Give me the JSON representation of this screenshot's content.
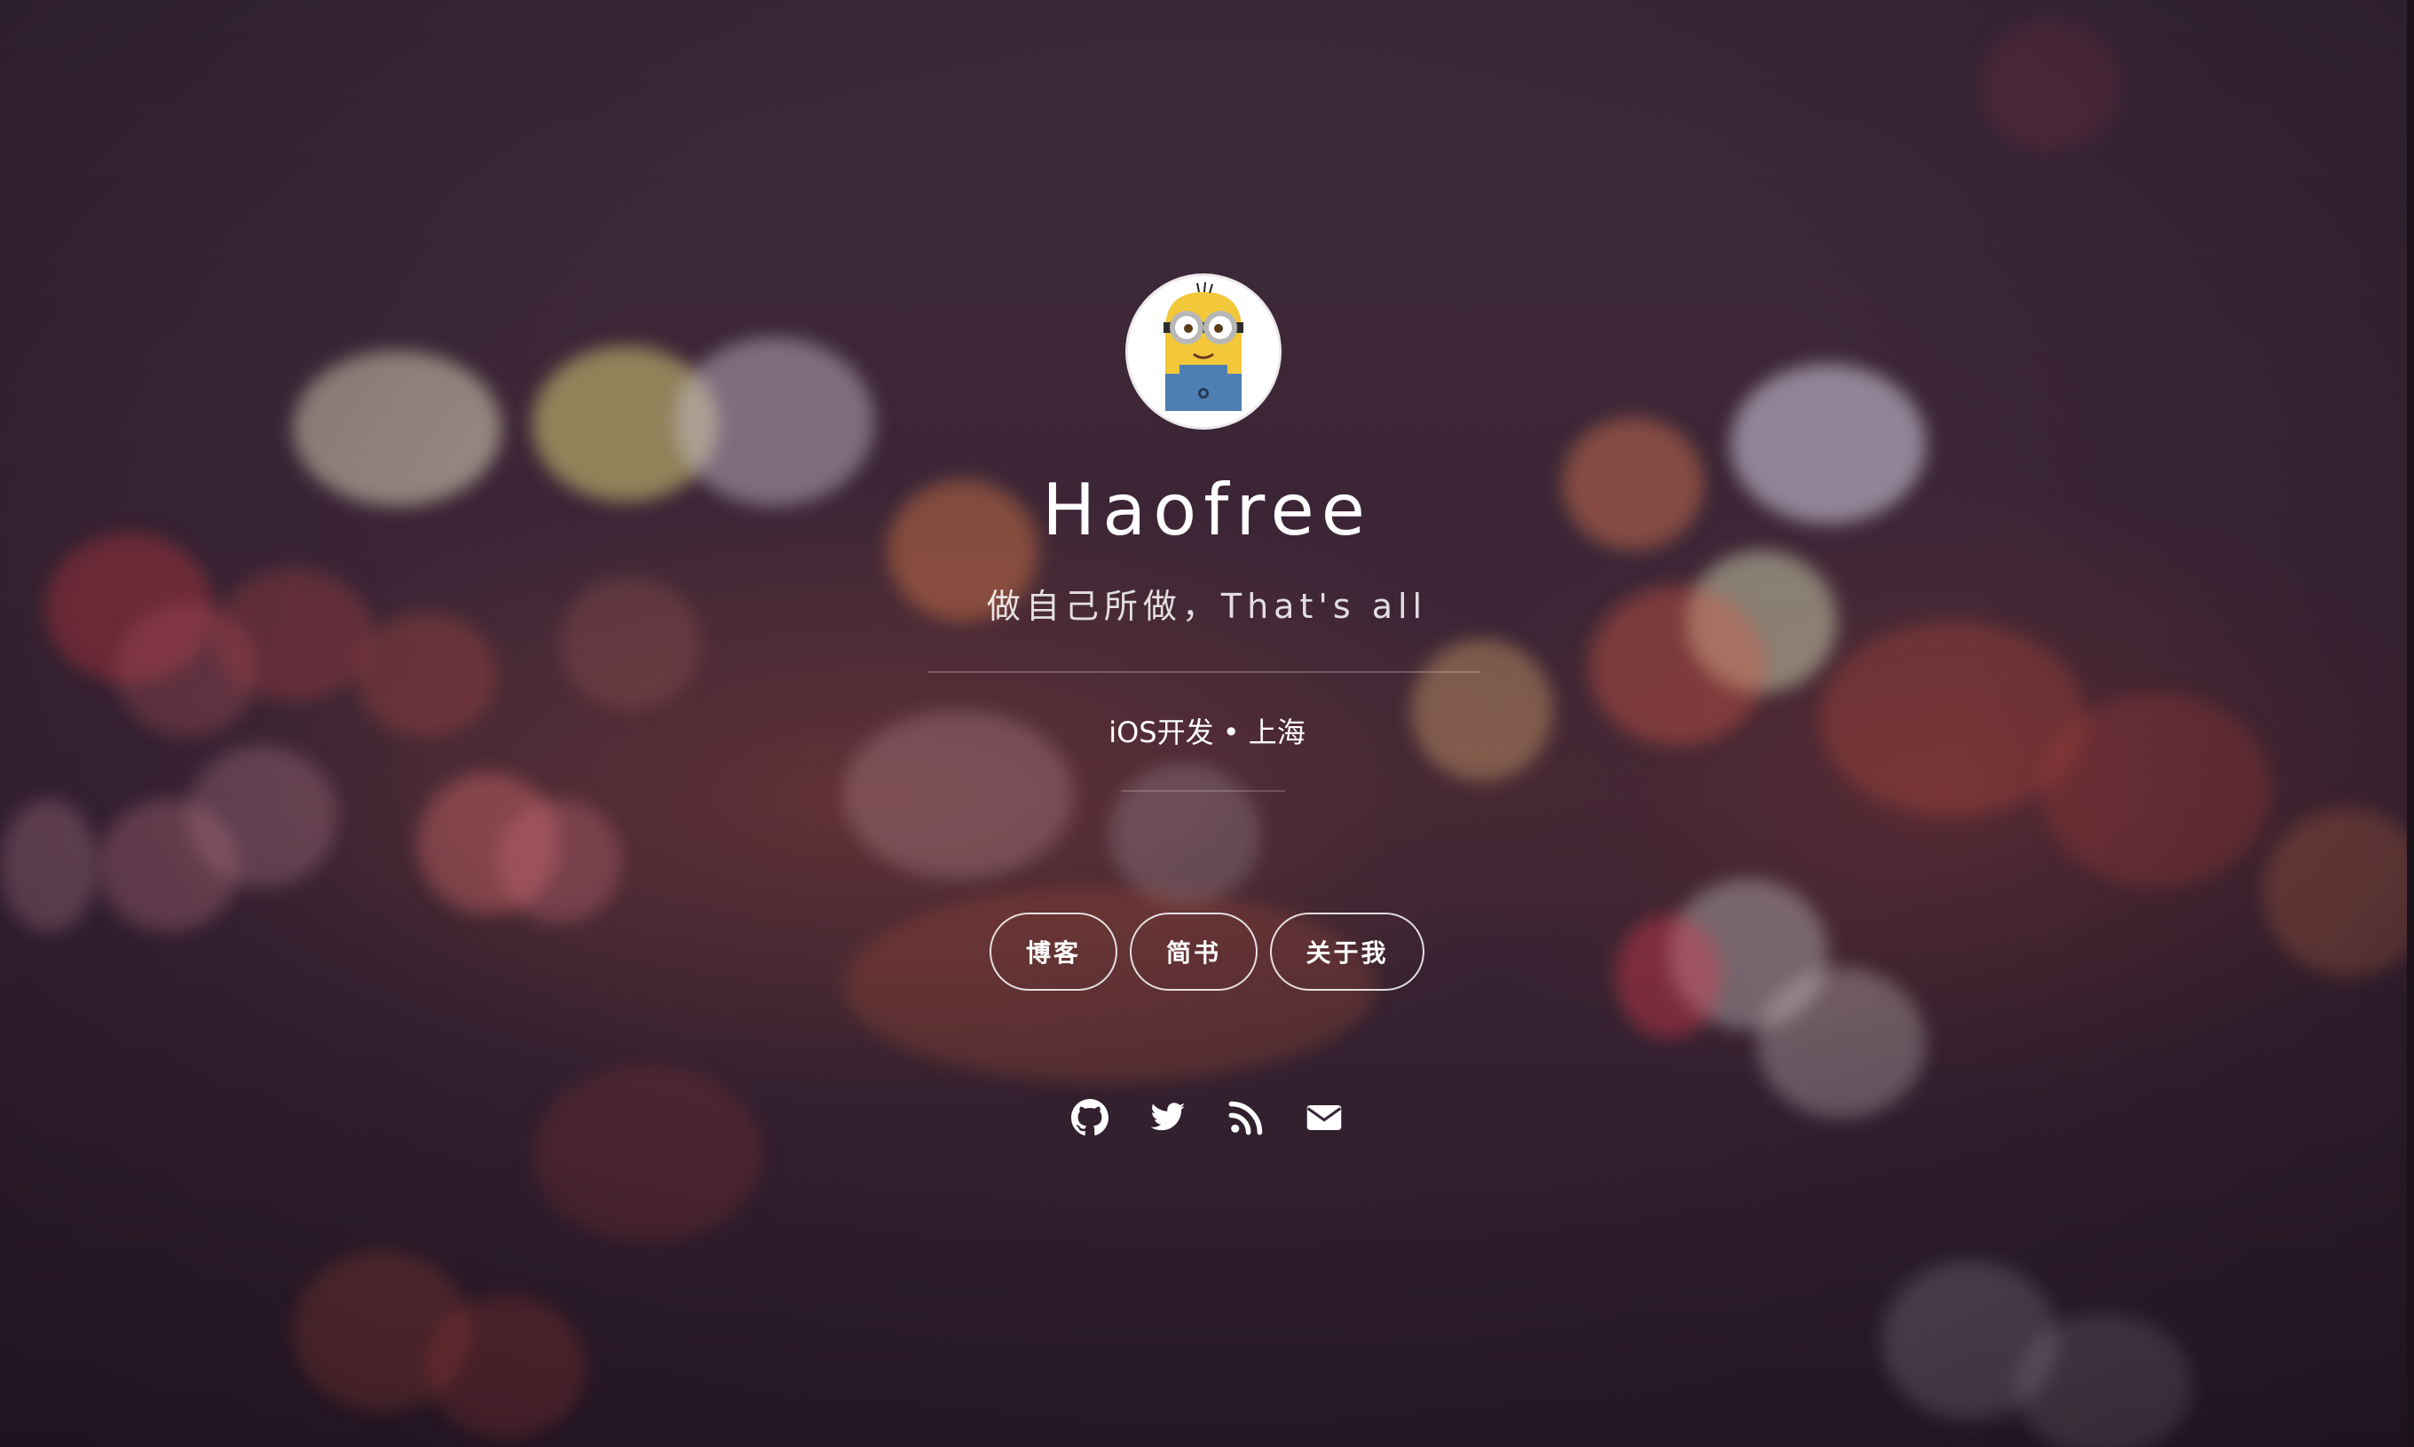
{
  "profile": {
    "name": "Haofree",
    "tagline": "做自己所做，That's all",
    "subtitle": "iOS开发 • 上海"
  },
  "nav": [
    {
      "label": "博客"
    },
    {
      "label": "简书"
    },
    {
      "label": "关于我"
    }
  ],
  "social": [
    {
      "icon": "github-icon"
    },
    {
      "icon": "twitter-icon"
    },
    {
      "icon": "rss-icon"
    },
    {
      "icon": "email-icon"
    }
  ],
  "colors": {
    "background": "#3a2638",
    "text": "#ffffff",
    "accent_warm": "#c8503c"
  }
}
